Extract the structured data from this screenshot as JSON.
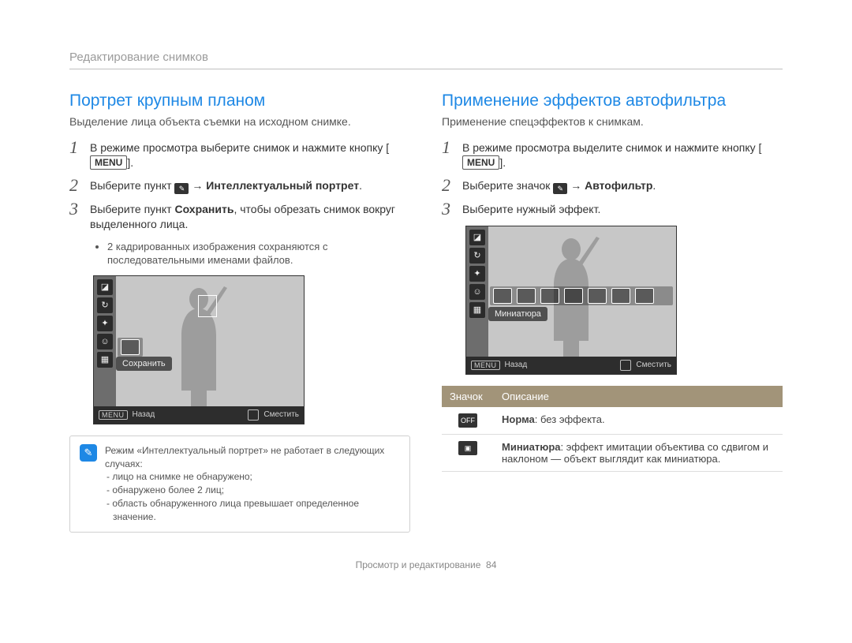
{
  "breadcrumb": "Редактирование снимков",
  "left": {
    "title": "Портрет крупным планом",
    "subtitle": "Выделение лица объекта съемки на исходном снимке.",
    "steps": [
      {
        "num": "1",
        "pre": "В режиме просмотра выберите снимок и нажмите кнопку [",
        "menu": "MENU",
        "post": "]."
      },
      {
        "num": "2",
        "pre": "Выберите пункт ",
        "icon": "edit-tools-icon",
        "mid": " → ",
        "bold": "Интеллектуальный портрет",
        "post": "."
      },
      {
        "num": "3",
        "pre": "Выберите пункт ",
        "bold": "Сохранить",
        "post": ", чтобы обрезать снимок вокруг выделенного лица."
      }
    ],
    "bullet": "2 кадрированных изображения сохраняются с последовательными именами файлов.",
    "screen": {
      "option_bubble": "Сохранить",
      "footer_back": "Назад",
      "footer_move": "Сместить",
      "menu_tag": "MENU"
    },
    "note": {
      "intro": "Режим «Интеллектуальный портрет» не работает в следующих случаях:",
      "items": [
        "лицо на снимке не обнаружено;",
        "обнаружено более 2 лиц;",
        "область обнаруженного лица превышает определенное значение."
      ]
    }
  },
  "right": {
    "title": "Применение эффектов автофильтра",
    "subtitle": "Применение спецэффектов к снимкам.",
    "steps": [
      {
        "num": "1",
        "pre": "В режиме просмотра выделите снимок и нажмите кнопку [",
        "menu": "MENU",
        "post": "]."
      },
      {
        "num": "2",
        "pre": "Выберите значок ",
        "icon": "edit-tools-icon",
        "mid": " → ",
        "bold": "Автофильтр",
        "post": "."
      },
      {
        "num": "3",
        "pre": "Выберите нужный эффект.",
        "post": ""
      }
    ],
    "screen": {
      "option_bubble": "Миниатюра",
      "footer_back": "Назад",
      "footer_move": "Сместить",
      "menu_tag": "MENU"
    },
    "table": {
      "head_icon": "Значок",
      "head_desc": "Описание",
      "rows": [
        {
          "icon": "norm-icon",
          "bold": "Норма",
          "rest": ": без эффекта."
        },
        {
          "icon": "miniature-icon",
          "bold": "Миниатюра",
          "rest": ": эффект имитации объектива со сдвигом и наклоном — объект выглядит как миниатюра."
        }
      ]
    }
  },
  "footer": {
    "label": "Просмотр и редактирование",
    "page": "84"
  }
}
